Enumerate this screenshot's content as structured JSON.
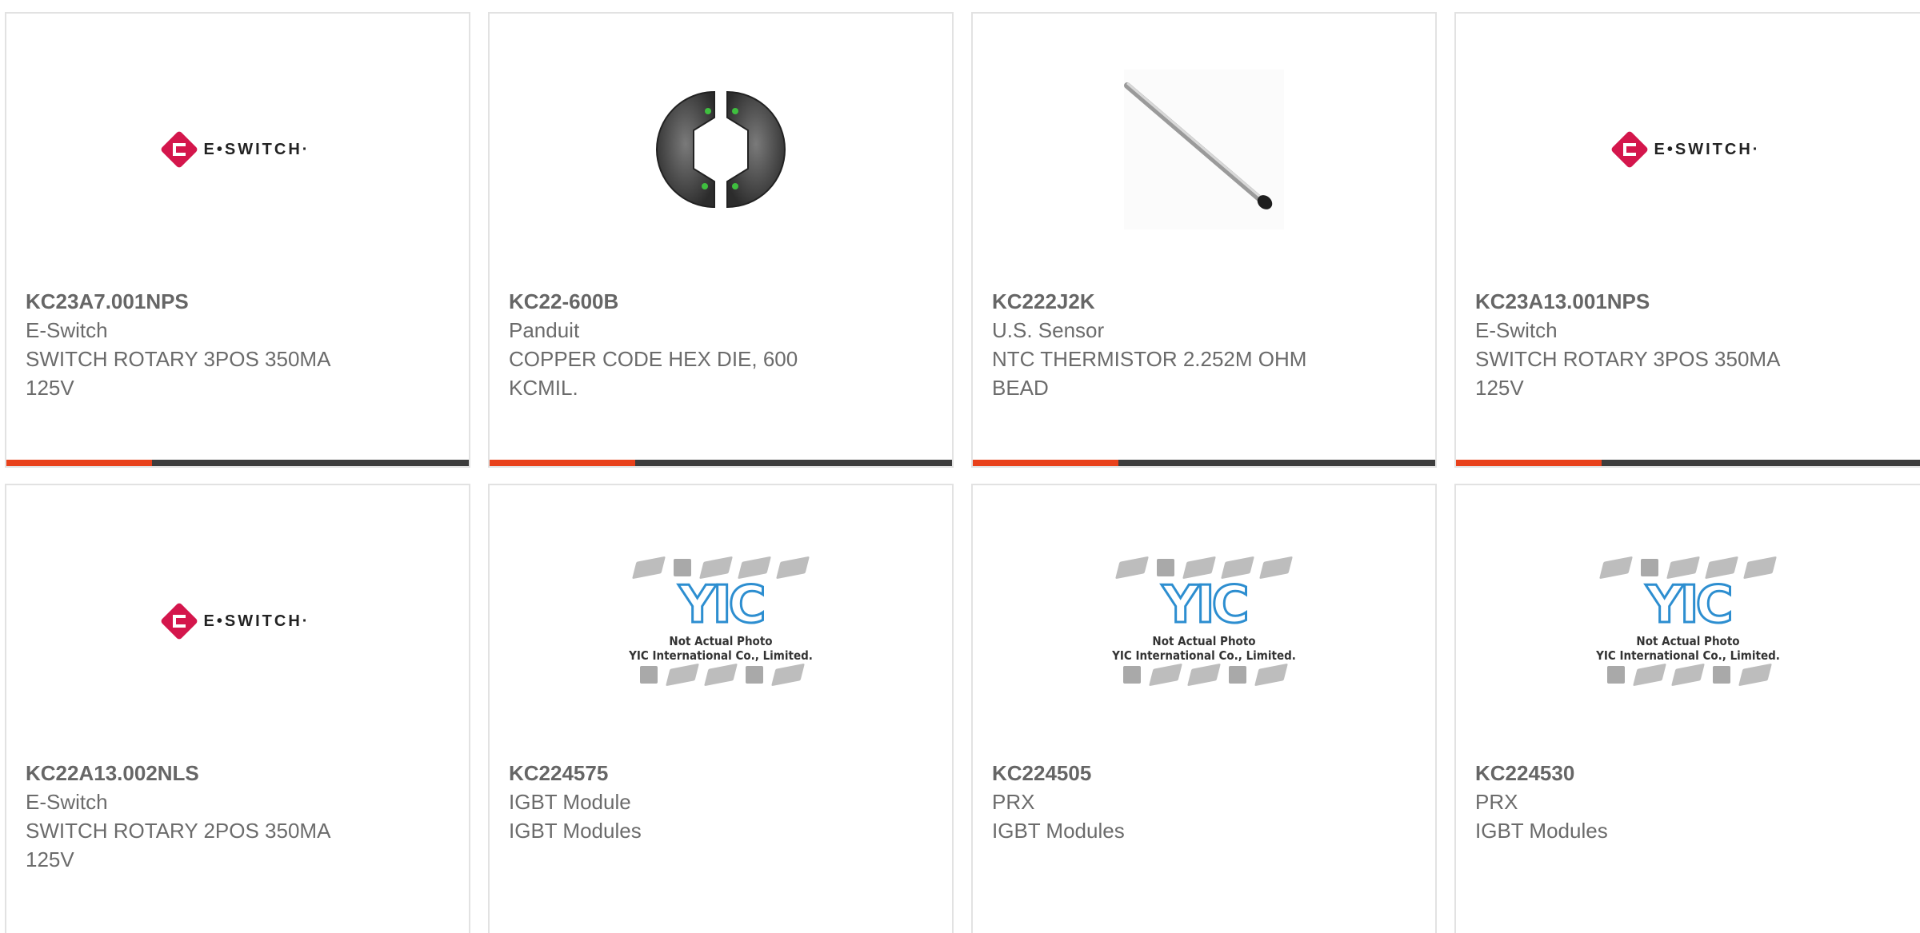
{
  "colors": {
    "accent": "#e8411b",
    "bar": "#3d3d3d",
    "esBrand": "#d4164c",
    "yicBlue": "#2d8ed0"
  },
  "products": [
    {
      "part_number": "KC23A7.001NPS",
      "manufacturer": "E-Switch",
      "description": "SWITCH ROTARY 3POS 350MA 125V",
      "image": "eswitch-logo"
    },
    {
      "part_number": "KC22-600B",
      "manufacturer": "Panduit",
      "description": "COPPER CODE HEX DIE, 600 KCMIL.",
      "image": "crimp-die-photo"
    },
    {
      "part_number": "KC222J2K",
      "manufacturer": "U.S. Sensor",
      "description": "NTC THERMISTOR 2.252M OHM BEAD",
      "image": "thermistor-probe-photo"
    },
    {
      "part_number": "KC23A13.001NPS",
      "manufacturer": "E-Switch",
      "description": "SWITCH ROTARY 3POS 350MA 125V",
      "image": "eswitch-logo"
    },
    {
      "part_number": "KC22A13.002NLS",
      "manufacturer": "E-Switch",
      "description": "SWITCH ROTARY 2POS 350MA 125V",
      "image": "eswitch-logo"
    },
    {
      "part_number": "KC224575",
      "manufacturer": "IGBT Module",
      "description": "IGBT Modules",
      "image": "yic-placeholder"
    },
    {
      "part_number": "KC224505",
      "manufacturer": "PRX",
      "description": "IGBT Modules",
      "image": "yic-placeholder"
    },
    {
      "part_number": "KC224530",
      "manufacturer": "PRX",
      "description": "IGBT Modules",
      "image": "yic-placeholder"
    }
  ],
  "eswitch_logo_text": "E•SWITCH·",
  "yic": {
    "word": "YIC",
    "caption_line1": "Not Actual Photo",
    "caption_line2": "YIC International Co., Limited."
  }
}
